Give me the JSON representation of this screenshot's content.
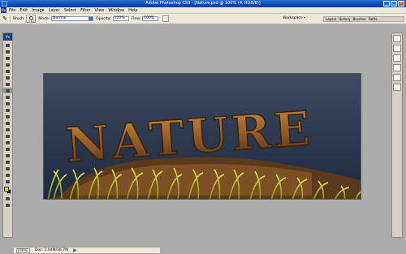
{
  "window": {
    "title": "Adobe Photoshop CS3 - [Nature.psd @ 100% (4, RGB/8)]",
    "app_icon": "photoshop-icon",
    "controls": [
      "minimize-icon",
      "maximize-icon",
      "close-icon"
    ]
  },
  "menu": {
    "logo": "Ps",
    "items": [
      "File",
      "Edit",
      "Image",
      "Layer",
      "Select",
      "Filter",
      "View",
      "Window",
      "Help"
    ]
  },
  "options_bar": {
    "brush_label": "Brush:",
    "brush_size": "112",
    "mode_label": "Mode:",
    "mode_value": "Normal",
    "opacity_label": "Opacity:",
    "opacity_value": "100%",
    "flow_label": "Flow:",
    "flow_value": "100%",
    "workspace_label": "Workspace ▾",
    "palette_tabs": [
      "Layers",
      "History",
      "Brushes",
      "Paths"
    ]
  },
  "toolbox": {
    "badge": "Ps",
    "foreground_color": "#e9d51b",
    "background_color": "#111111"
  },
  "document": {
    "text": "NATURE"
  },
  "status": {
    "zoom": "100%",
    "doc": "Doc: 1.04M/36.7M"
  }
}
